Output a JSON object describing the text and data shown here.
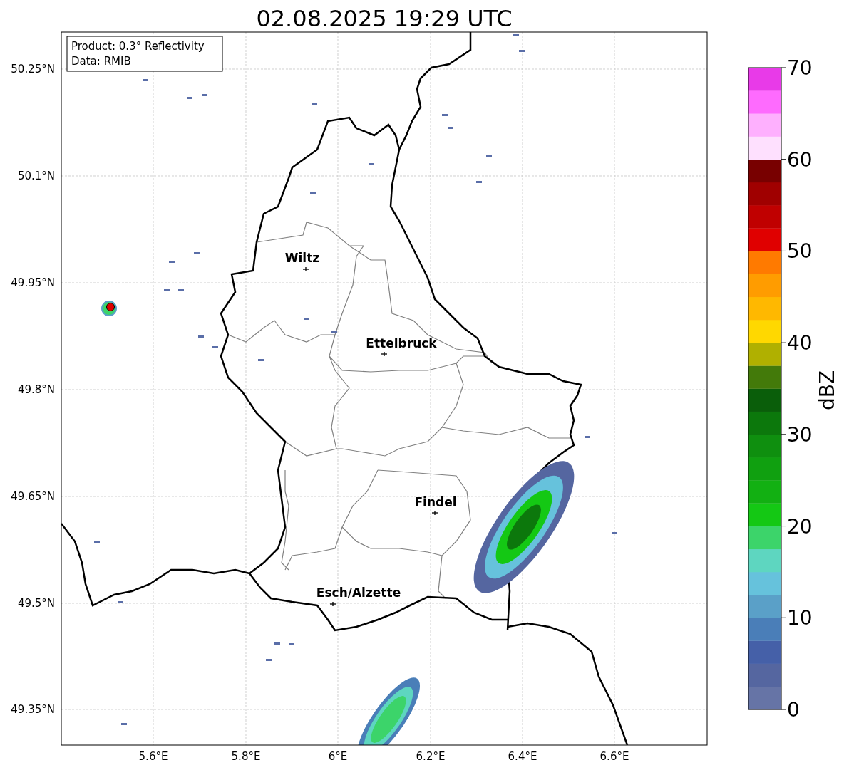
{
  "title": "02.08.2025 19:29 UTC",
  "info_box": [
    "Product: 0.3° Reflectivity",
    "Data: RMIB"
  ],
  "x_ticks": [
    "5.6°E",
    "5.8°E",
    "6°E",
    "6.2°E",
    "6.4°E",
    "6.6°E"
  ],
  "y_ticks": [
    "50.25°N",
    "50.1°N",
    "49.95°N",
    "49.8°N",
    "49.65°N",
    "49.5°N",
    "49.35°N"
  ],
  "cities": [
    {
      "name": "Wiltz"
    },
    {
      "name": "Ettelbruck"
    },
    {
      "name": "Findel"
    },
    {
      "name": "Esch/Alzette"
    }
  ],
  "colorbar": {
    "label": "dBZ",
    "ticks": [
      "70",
      "60",
      "50",
      "40",
      "30",
      "20",
      "10",
      "0"
    ],
    "bands": [
      {
        "color": "#6674a6"
      },
      {
        "color": "#5566a0"
      },
      {
        "color": "#4560a8"
      },
      {
        "color": "#4a7eb8"
      },
      {
        "color": "#5aa0c8"
      },
      {
        "color": "#66c2dc"
      },
      {
        "color": "#5ed6c0"
      },
      {
        "color": "#3cd46a"
      },
      {
        "color": "#14c814"
      },
      {
        "color": "#12b012"
      },
      {
        "color": "#10a010"
      },
      {
        "color": "#0f8f0f"
      },
      {
        "color": "#0c780c"
      },
      {
        "color": "#0a5e0a"
      },
      {
        "color": "#437a0a"
      },
      {
        "color": "#b0b000"
      },
      {
        "color": "#ffd800"
      },
      {
        "color": "#ffb800"
      },
      {
        "color": "#ff9c00"
      },
      {
        "color": "#ff7a00"
      },
      {
        "color": "#e00000"
      },
      {
        "color": "#c00000"
      },
      {
        "color": "#a00000"
      },
      {
        "color": "#780000"
      },
      {
        "color": "#fee0fe"
      },
      {
        "color": "#feb0fe"
      },
      {
        "color": "#fe6bfe"
      },
      {
        "color": "#e83ae8"
      }
    ]
  }
}
